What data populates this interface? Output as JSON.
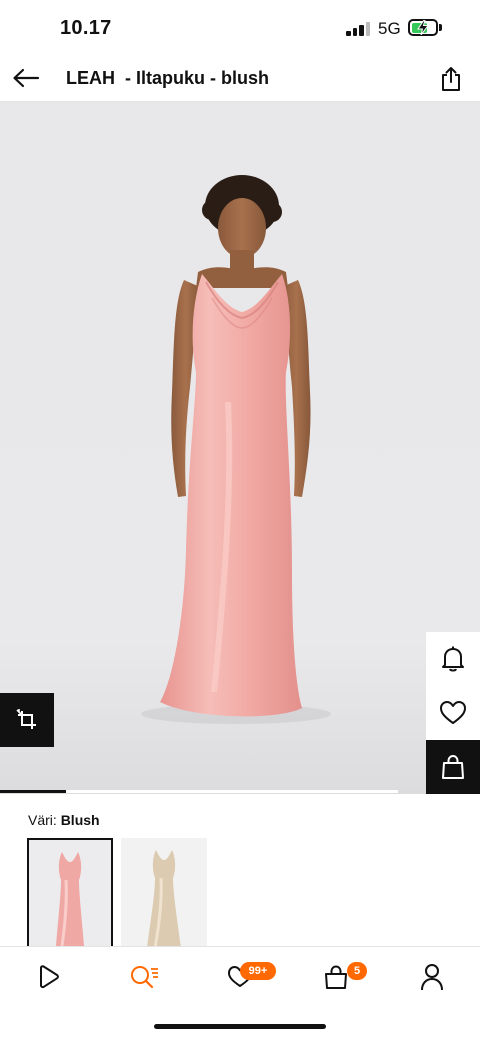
{
  "status_bar": {
    "time": "10.17",
    "network": "5G"
  },
  "header": {
    "title": "LEAH  - Iltapuku - blush",
    "back_icon": "arrow-left-icon",
    "share_icon": "share-icon"
  },
  "product_image": {
    "alt": "",
    "gallery_position": 0.14
  },
  "side_actions": {
    "notify_icon": "bell-icon",
    "wishlist_icon": "heart-icon",
    "cart_icon": "shopping-bag-icon",
    "fit_icon": "crop-icon"
  },
  "color": {
    "label": "Väri:",
    "selected": "Blush",
    "swatch_colors": [
      "#f0a8a4",
      "#dccbb0"
    ]
  },
  "bottom_nav": {
    "items": [
      {
        "icon": "play-icon"
      },
      {
        "icon": "search-list-icon",
        "color": "#ff6900"
      },
      {
        "icon": "heart-icon",
        "badge": "99+"
      },
      {
        "icon": "bag-icon",
        "badge": "5"
      },
      {
        "icon": "user-icon"
      }
    ]
  },
  "colors": {
    "accent": "#ff6900",
    "dress": "#f1aaa6",
    "background": "#e8e8ea"
  }
}
